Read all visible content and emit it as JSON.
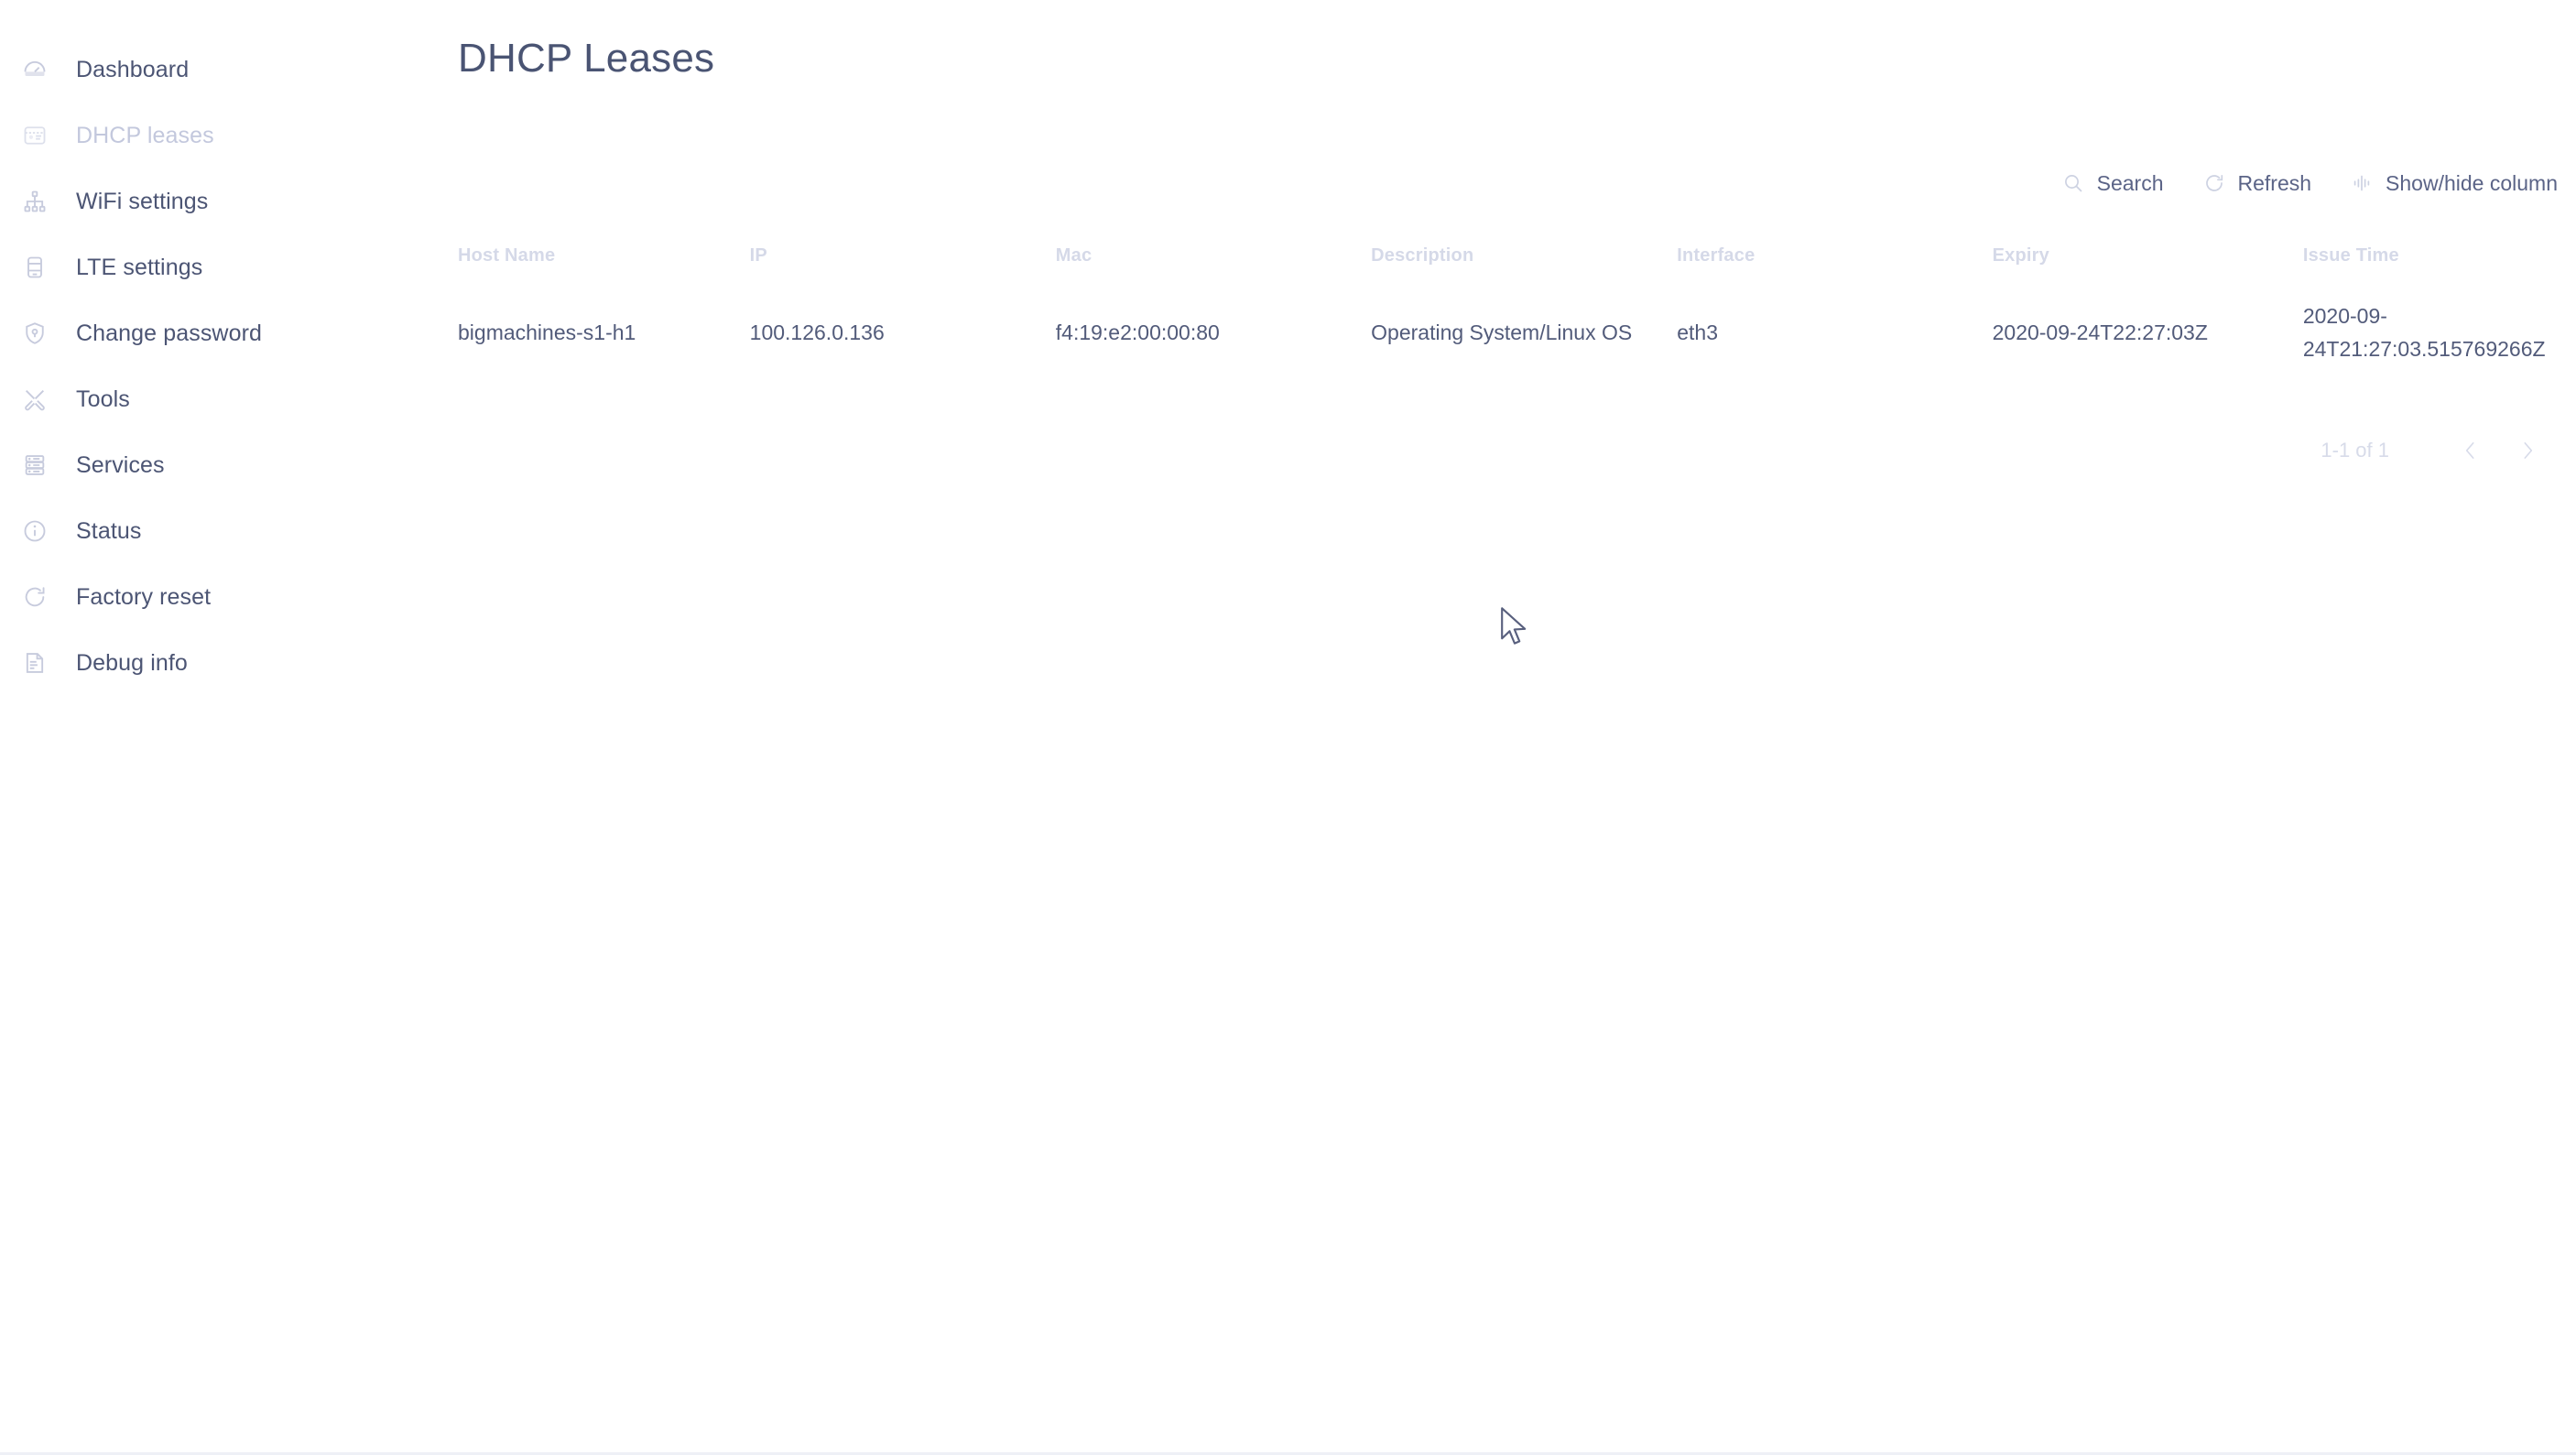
{
  "sidebar": {
    "items": [
      {
        "label": "Dashboard",
        "icon": "gauge-icon",
        "active": false
      },
      {
        "label": "DHCP leases",
        "icon": "id-card-icon",
        "active": true
      },
      {
        "label": "WiFi settings",
        "icon": "sitemap-icon",
        "active": false
      },
      {
        "label": "LTE settings",
        "icon": "mobile-device-icon",
        "active": false
      },
      {
        "label": "Change password",
        "icon": "shield-lock-icon",
        "active": false
      },
      {
        "label": "Tools",
        "icon": "tools-icon",
        "active": false
      },
      {
        "label": "Services",
        "icon": "server-icon",
        "active": false
      },
      {
        "label": "Status",
        "icon": "info-circle-icon",
        "active": false
      },
      {
        "label": "Factory reset",
        "icon": "reset-arrow-icon",
        "active": false
      },
      {
        "label": "Debug info",
        "icon": "debug-note-icon",
        "active": false
      }
    ]
  },
  "page": {
    "title": "DHCP Leases"
  },
  "toolbar": {
    "search_label": "Search",
    "refresh_label": "Refresh",
    "show_hide_label": "Show/hide column"
  },
  "table": {
    "columns": [
      "Host Name",
      "IP",
      "Mac",
      "Description",
      "Interface",
      "Expiry",
      "Issue Time"
    ],
    "rows": [
      {
        "host_name": "bigmachines-s1-h1",
        "ip": "100.126.0.136",
        "mac": "f4:19:e2:00:00:80",
        "description": "Operating System/Linux OS",
        "interface": "eth3",
        "expiry": "2020-09-24T22:27:03Z",
        "issue_time": "2020-09-24T21:27:03.515769266Z"
      }
    ]
  },
  "pagination": {
    "range": "1-1 of 1",
    "prev_label": "‹",
    "next_label": "›"
  },
  "colors": {
    "text_primary": "#4c5574",
    "text_muted": "#d5d9e8",
    "icon": "#cdd2e2",
    "active_item": "#c3c8dd"
  }
}
